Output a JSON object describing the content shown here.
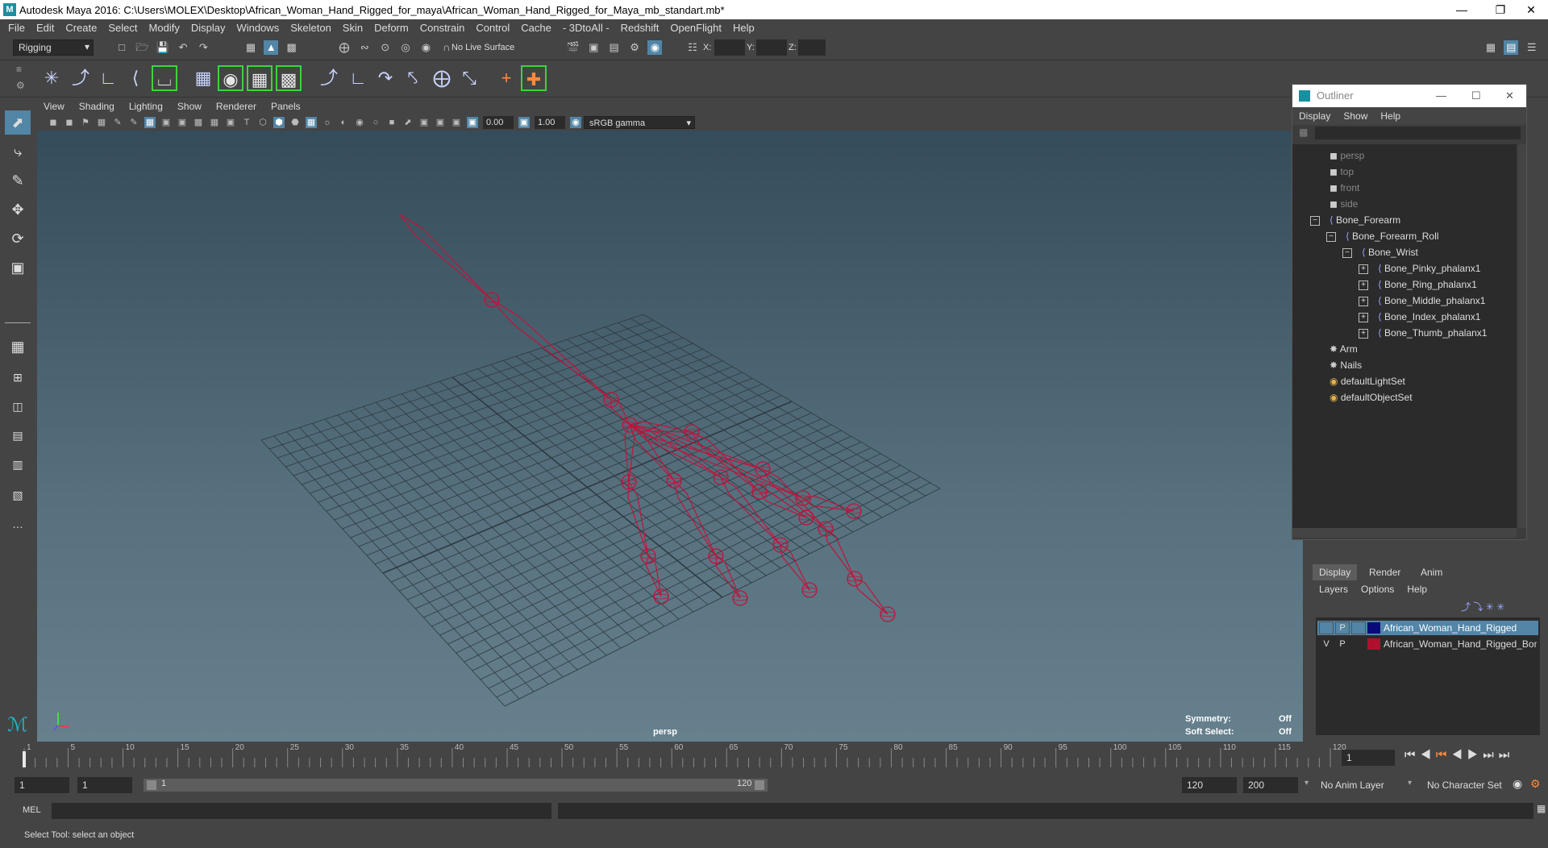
{
  "window": {
    "title": "Autodesk Maya 2016: C:\\Users\\MOLEX\\Desktop\\African_Woman_Hand_Rigged_for_maya\\African_Woman_Hand_Rigged_for_Maya_mb_standart.mb*",
    "minimize_icon": "minimize-icon",
    "maximize_icon": "restore-icon",
    "close_icon": "close-icon"
  },
  "menubar": [
    "File",
    "Edit",
    "Create",
    "Select",
    "Modify",
    "Display",
    "Windows",
    "Skeleton",
    "Skin",
    "Deform",
    "Constrain",
    "Control",
    "Cache",
    "- 3DtoAll -",
    "Redshift",
    "OpenFlight",
    "Help"
  ],
  "statusline": {
    "menuset": "Rigging",
    "live_surface": "No Live Surface",
    "x_label": "X:",
    "y_label": "Y:",
    "z_label": "Z:"
  },
  "viewport": {
    "menu": [
      "View",
      "Shading",
      "Lighting",
      "Show",
      "Renderer",
      "Panels"
    ],
    "exposure": "0.00",
    "gamma": "1.00",
    "color_space": "sRGB gamma",
    "camera_label": "persp",
    "hud": {
      "symmetry_label": "Symmetry:",
      "symmetry_value": "Off",
      "soft_select_label": "Soft Select:",
      "soft_select_value": "Off"
    },
    "joint_color": "#c0143c",
    "grid_color": "#2e3a40"
  },
  "outliner": {
    "title": "Outliner",
    "menu": [
      "Display",
      "Show",
      "Help"
    ],
    "items": [
      {
        "label": "persp",
        "type": "camera",
        "dim": true
      },
      {
        "label": "top",
        "type": "camera",
        "dim": true
      },
      {
        "label": "front",
        "type": "camera",
        "dim": true
      },
      {
        "label": "side",
        "type": "camera",
        "dim": true
      },
      {
        "label": "Bone_Forearm",
        "type": "joint"
      },
      {
        "label": "Bone_Forearm_Roll",
        "type": "joint"
      },
      {
        "label": "Bone_Wrist",
        "type": "joint"
      },
      {
        "label": "Bone_Pinky_phalanx1",
        "type": "joint"
      },
      {
        "label": "Bone_Ring_phalanx1",
        "type": "joint"
      },
      {
        "label": "Bone_Middle_phalanx1",
        "type": "joint"
      },
      {
        "label": "Bone_Index_phalanx1",
        "type": "joint"
      },
      {
        "label": "Bone_Thumb_phalanx1",
        "type": "joint"
      },
      {
        "label": "Arm",
        "type": "mesh"
      },
      {
        "label": "Nails",
        "type": "mesh"
      },
      {
        "label": "defaultLightSet",
        "type": "set"
      },
      {
        "label": "defaultObjectSet",
        "type": "set"
      }
    ]
  },
  "layer_editor": {
    "tabs": [
      "Display",
      "Render",
      "Anim"
    ],
    "menu": [
      "Layers",
      "Options",
      "Help"
    ],
    "layers": [
      {
        "v": "",
        "p": "P",
        "name": "African_Woman_Hand_Rigged",
        "color": "#0a0a7a",
        "selected": true
      },
      {
        "v": "V",
        "p": "P",
        "name": "African_Woman_Hand_Rigged_Bon",
        "color": "#b0102e",
        "selected": false
      }
    ]
  },
  "timeline": {
    "ticks": [
      "1",
      "5",
      "10",
      "15",
      "20",
      "25",
      "30",
      "35",
      "40",
      "45",
      "50",
      "55",
      "60",
      "65",
      "70",
      "75",
      "80",
      "85",
      "90",
      "95",
      "100",
      "105",
      "110",
      "115",
      "120"
    ],
    "current_frame": "1"
  },
  "range": {
    "start": "1",
    "playback_start": "1",
    "slider_start": "1",
    "slider_end": "120",
    "playback_end": "120",
    "end": "200",
    "anim_layer": "No Anim Layer",
    "character_set": "No Character Set"
  },
  "command_line": {
    "label": "MEL"
  },
  "help_line": "Select Tool: select an object"
}
